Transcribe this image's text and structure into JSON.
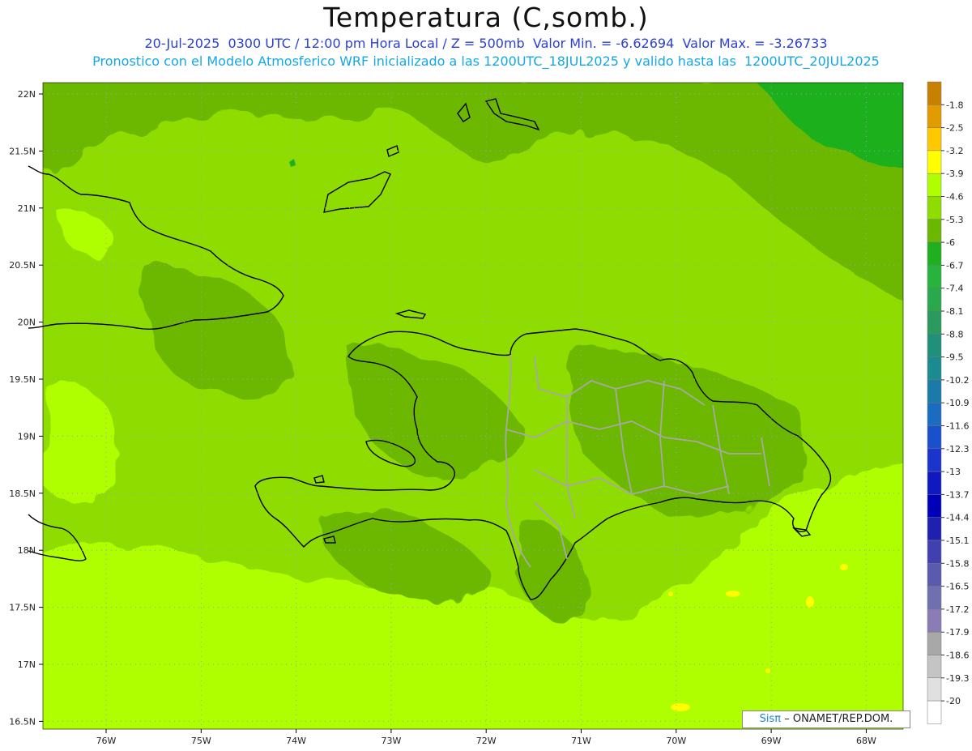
{
  "title": "Temperatura (C,somb.)",
  "subtitle1": "20-Jul-2025  0300 UTC / 12:00 pm Hora Local / Z = 500mb  Valor Min. = -6.62694  Valor Max. = -3.26733",
  "subtitle2": "Pronostico con el Modelo Atmosferico WRF inicializado a las 1200UTC_18JUL2025 y valido hasta las  1200UTC_20JUL2025",
  "credit": {
    "logo": "Sisπ",
    "text": "– ONAMET/REP.DOM."
  },
  "lat_ticks": [
    "22N",
    "21.5N",
    "21N",
    "20.5N",
    "20N",
    "19.5N",
    "19N",
    "18.5N",
    "18N",
    "17.5N",
    "17N",
    "16.5N"
  ],
  "lon_ticks": [
    "76W",
    "75W",
    "74W",
    "73W",
    "72W",
    "71W",
    "70W",
    "69W",
    "68W"
  ],
  "colorbar": {
    "labels": [
      "-1.8",
      "-2.5",
      "-3.2",
      "-3.9",
      "-4.6",
      "-5.3",
      "-6",
      "-6.7",
      "-7.4",
      "-8.1",
      "-8.8",
      "-9.5",
      "-10.2",
      "-10.9",
      "-11.6",
      "-12.3",
      "-13",
      "-13.7",
      "-14.4",
      "-15.1",
      "-15.8",
      "-16.5",
      "-17.2",
      "-17.9",
      "-18.6",
      "-19.3",
      "-20"
    ],
    "colors": [
      "#c88000",
      "#e39c00",
      "#ffc800",
      "#ffff00",
      "#b0ff00",
      "#8fdc00",
      "#6cb800",
      "#1fb01f",
      "#27b43c",
      "#2aa84e",
      "#2a9a5e",
      "#20907a",
      "#1a8c90",
      "#1a7aa8",
      "#1a6cc0",
      "#1a50cc",
      "#1a34cc",
      "#1018c0",
      "#0000b8",
      "#2020b0",
      "#4040b0",
      "#5a5aae",
      "#7070b0",
      "#8c7cb6",
      "#a8a8a8",
      "#c4c4c4",
      "#e0e0e0",
      "#ffffff"
    ]
  }
}
